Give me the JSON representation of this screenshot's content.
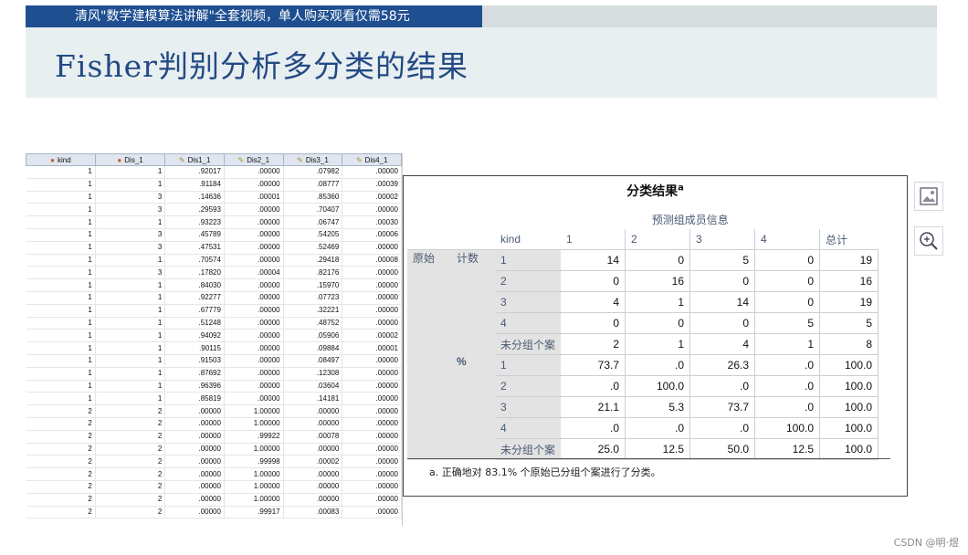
{
  "banner": {
    "text": "清风\"数学建模算法讲解\"全套视频，单人购买观看仅需58元"
  },
  "slide_title": "Fisher判别分析多分类的结果",
  "grid": {
    "columns": [
      "kind",
      "Dis_1",
      "Dis1_1",
      "Dis2_1",
      "Dis3_1",
      "Dis4_1"
    ],
    "column_icons": [
      "nominal-icon",
      "nominal-icon",
      "scale-icon",
      "scale-icon",
      "scale-icon",
      "scale-icon"
    ],
    "rows": [
      [
        "1",
        "1",
        ".92017",
        ".00000",
        ".07982",
        ".00000"
      ],
      [
        "1",
        "1",
        ".91184",
        ".00000",
        ".08777",
        ".00039"
      ],
      [
        "1",
        "3",
        ".14636",
        ".00001",
        ".85360",
        ".00002"
      ],
      [
        "1",
        "3",
        ".29593",
        ".00000",
        ".70407",
        ".00000"
      ],
      [
        "1",
        "1",
        ".93223",
        ".00000",
        ".06747",
        ".00030"
      ],
      [
        "1",
        "3",
        ".45789",
        ".00000",
        ".54205",
        ".00006"
      ],
      [
        "1",
        "3",
        ".47531",
        ".00000",
        ".52469",
        ".00000"
      ],
      [
        "1",
        "1",
        ".70574",
        ".00000",
        ".29418",
        ".00008"
      ],
      [
        "1",
        "3",
        ".17820",
        ".00004",
        ".82176",
        ".00000"
      ],
      [
        "1",
        "1",
        ".84030",
        ".00000",
        ".15970",
        ".00000"
      ],
      [
        "1",
        "1",
        ".92277",
        ".00000",
        ".07723",
        ".00000"
      ],
      [
        "1",
        "1",
        ".67779",
        ".00000",
        ".32221",
        ".00000"
      ],
      [
        "1",
        "1",
        ".51248",
        ".00000",
        ".48752",
        ".00000"
      ],
      [
        "1",
        "1",
        ".94092",
        ".00000",
        ".05906",
        ".00002"
      ],
      [
        "1",
        "1",
        ".90115",
        ".00000",
        ".09884",
        ".00001"
      ],
      [
        "1",
        "1",
        ".91503",
        ".00000",
        ".08497",
        ".00000"
      ],
      [
        "1",
        "1",
        ".87692",
        ".00000",
        ".12308",
        ".00000"
      ],
      [
        "1",
        "1",
        ".96396",
        ".00000",
        ".03604",
        ".00000"
      ],
      [
        "1",
        "1",
        ".85819",
        ".00000",
        ".14181",
        ".00000"
      ],
      [
        "2",
        "2",
        ".00000",
        "1.00000",
        ".00000",
        ".00000"
      ],
      [
        "2",
        "2",
        ".00000",
        "1.00000",
        ".00000",
        ".00000"
      ],
      [
        "2",
        "2",
        ".00000",
        ".99922",
        ".00078",
        ".00000"
      ],
      [
        "2",
        "2",
        ".00000",
        "1.00000",
        ".00000",
        ".00000"
      ],
      [
        "2",
        "2",
        ".00000",
        ".99998",
        ".00002",
        ".00000"
      ],
      [
        "2",
        "2",
        ".00000",
        "1.00000",
        ".00000",
        ".00000"
      ],
      [
        "2",
        "2",
        ".00000",
        "1.00000",
        ".00000",
        ".00000"
      ],
      [
        "2",
        "2",
        ".00000",
        "1.00000",
        ".00000",
        ".00000"
      ],
      [
        "2",
        "2",
        ".00000",
        ".99917",
        ".00083",
        ".00000"
      ]
    ]
  },
  "result": {
    "title": "分类结果",
    "title_sup": "a",
    "group_header": "预测组成员信息",
    "row_var": "kind",
    "cols": [
      "1",
      "2",
      "3",
      "4"
    ],
    "total_label": "总计",
    "original_label": "原始",
    "count_label": "计数",
    "percent_label": "%",
    "ungrouped_label": "未分组个案",
    "count_rows": [
      {
        "label": "1",
        "values": [
          "14",
          "0",
          "5",
          "0"
        ],
        "total": "19"
      },
      {
        "label": "2",
        "values": [
          "0",
          "16",
          "0",
          "0"
        ],
        "total": "16"
      },
      {
        "label": "3",
        "values": [
          "4",
          "1",
          "14",
          "0"
        ],
        "total": "19"
      },
      {
        "label": "4",
        "values": [
          "0",
          "0",
          "0",
          "5"
        ],
        "total": "5"
      },
      {
        "label": "未分组个案",
        "values": [
          "2",
          "1",
          "4",
          "1"
        ],
        "total": "8"
      }
    ],
    "percent_rows": [
      {
        "label": "1",
        "values": [
          "73.7",
          ".0",
          "26.3",
          ".0"
        ],
        "total": "100.0"
      },
      {
        "label": "2",
        "values": [
          ".0",
          "100.0",
          ".0",
          ".0"
        ],
        "total": "100.0"
      },
      {
        "label": "3",
        "values": [
          "21.1",
          "5.3",
          "73.7",
          ".0"
        ],
        "total": "100.0"
      },
      {
        "label": "4",
        "values": [
          ".0",
          ".0",
          ".0",
          "100.0"
        ],
        "total": "100.0"
      },
      {
        "label": "未分组个案",
        "values": [
          "25.0",
          "12.5",
          "50.0",
          "12.5"
        ],
        "total": "100.0"
      }
    ],
    "footnote": "a. 正确地对 83.1% 个原始已分组个案进行了分类。"
  },
  "side_icons": [
    "image-icon",
    "zoom-in-icon"
  ],
  "watermark": "CSDN @明·煜"
}
